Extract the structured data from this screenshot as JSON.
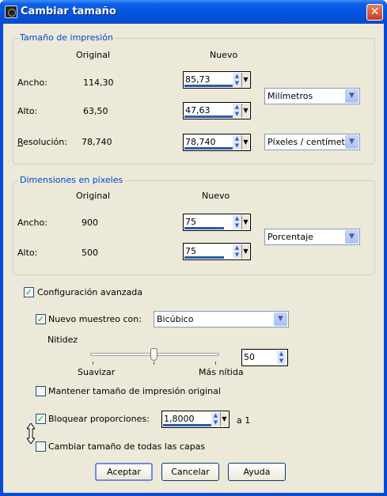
{
  "window": {
    "title": "Cambiar tamaño",
    "close_label": "✕"
  },
  "print_size": {
    "group_label": "Tamaño de impresión",
    "col_original": "Original",
    "col_new": "Nuevo",
    "width": {
      "label": "Ancho:",
      "original": "114,30",
      "new": "85,73"
    },
    "height": {
      "label": "Alto:",
      "original": "63,50",
      "new": "47,63"
    },
    "resolution": {
      "label": "Resolución:",
      "original": "78,740",
      "new": "78,740"
    },
    "units_value": "Milímetros",
    "res_units_value": "Píxeles / centímetro"
  },
  "pixel_dims": {
    "group_label": "Dimensiones en píxeles",
    "col_original": "Original",
    "col_new": "Nuevo",
    "width": {
      "label": "Ancho:",
      "original": "900",
      "new": "75"
    },
    "height": {
      "label": "Alto:",
      "original": "500",
      "new": "75"
    },
    "units_value": "Porcentaje"
  },
  "advanced": {
    "advanced_label": "Configuración avanzada",
    "advanced_checked": true,
    "resample_label": "Nuevo muestreo con:",
    "resample_checked": true,
    "resample_value": "Bicúbico",
    "sharpness_label": "Nitidez",
    "sharpness_value": "50",
    "sharpness_level": 0.5,
    "slider_left_label": "Suavizar",
    "slider_right_label": "Más nítida",
    "keep_print_label": "Mantener tamaño de impresión original",
    "keep_print_checked": false,
    "lock_ratio_label": "Bloquear proporciones:",
    "lock_ratio_checked": true,
    "ratio_value": "1,8000",
    "ratio_suffix": "a 1",
    "all_layers_label": "Cambiar tamaño de todas las capas",
    "all_layers_checked": false
  },
  "buttons": {
    "ok": "Aceptar",
    "cancel": "Cancelar",
    "help": "Ayuda"
  }
}
